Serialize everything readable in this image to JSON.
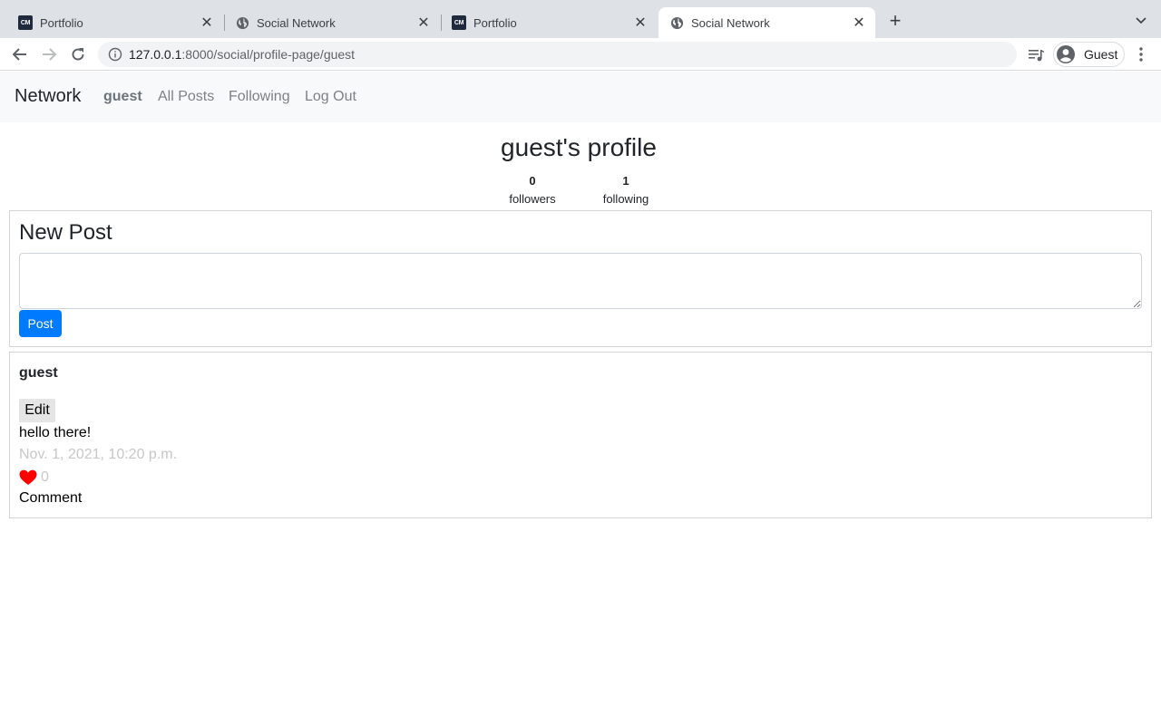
{
  "browser": {
    "tabs": [
      {
        "title": "Portfolio",
        "icon": "cm-favicon-icon",
        "active": false
      },
      {
        "title": "Social Network",
        "icon": "globe-icon",
        "active": false
      },
      {
        "title": "Portfolio",
        "icon": "cm-favicon-icon",
        "active": false
      },
      {
        "title": "Social Network",
        "icon": "globe-icon",
        "active": true
      }
    ],
    "cm_favicon_text": "CM",
    "url_host": "127.0.0.1",
    "url_rest": ":8000/social/profile-page/guest",
    "profile_name": "Guest"
  },
  "navbar": {
    "brand": "Network",
    "user": "guest",
    "all_posts": "All Posts",
    "following": "Following",
    "logout": "Log Out"
  },
  "profile": {
    "title": "guest's profile",
    "followers_count": "0",
    "followers_label": "followers",
    "following_count": "1",
    "following_label": "following"
  },
  "new_post": {
    "heading": "New Post",
    "textarea_value": "",
    "submit_label": "Post"
  },
  "posts": [
    {
      "author": "guest",
      "edit_label": "Edit",
      "body": "hello there!",
      "timestamp": "Nov. 1, 2021, 10:20 p.m.",
      "likes": "0",
      "comment_label": "Comment"
    }
  ],
  "colors": {
    "primary": "#007bff",
    "heart": "#ff0000",
    "muted": "#c7c7c7"
  }
}
